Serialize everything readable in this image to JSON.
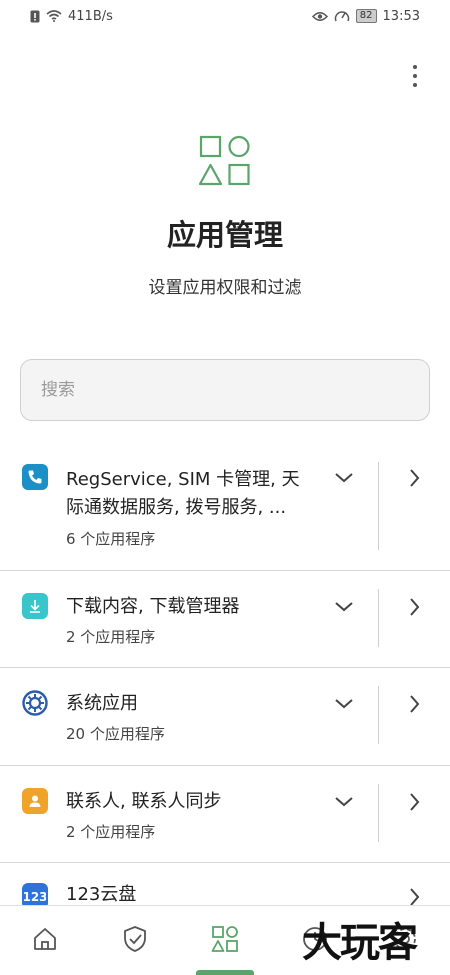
{
  "status_bar": {
    "net_speed": "411B/s",
    "battery": "82",
    "time": "13:53"
  },
  "header": {
    "title": "应用管理",
    "subtitle": "设置应用权限和过滤"
  },
  "search": {
    "placeholder": "搜索"
  },
  "app_groups": [
    {
      "title": "RegService, SIM 卡管理, 天际通数据服务, 拨号服务, ...",
      "count": "6 个应用程序",
      "icon": "phone-icon",
      "color": "#1b8fc6"
    },
    {
      "title": "下载内容, 下载管理器",
      "count": "2 个应用程序",
      "icon": "download-icon",
      "color": "#39c5c9"
    },
    {
      "title": "系统应用",
      "count": "20 个应用程序",
      "icon": "system-gear-icon",
      "color": "#2b5cab"
    },
    {
      "title": "联系人, 联系人同步",
      "count": "2 个应用程序",
      "icon": "contacts-icon",
      "color": "#f0a32a"
    },
    {
      "title": "123云盘",
      "count": "",
      "icon": "cloud-123-icon",
      "color": "#2d73d9"
    }
  ],
  "bottom_nav": {
    "tabs": [
      "home-icon",
      "shield-check-icon",
      "apps-grid-icon",
      "history-icon",
      "settings-icon"
    ],
    "active_color": "#5aa66a"
  },
  "watermark": "大玩客"
}
